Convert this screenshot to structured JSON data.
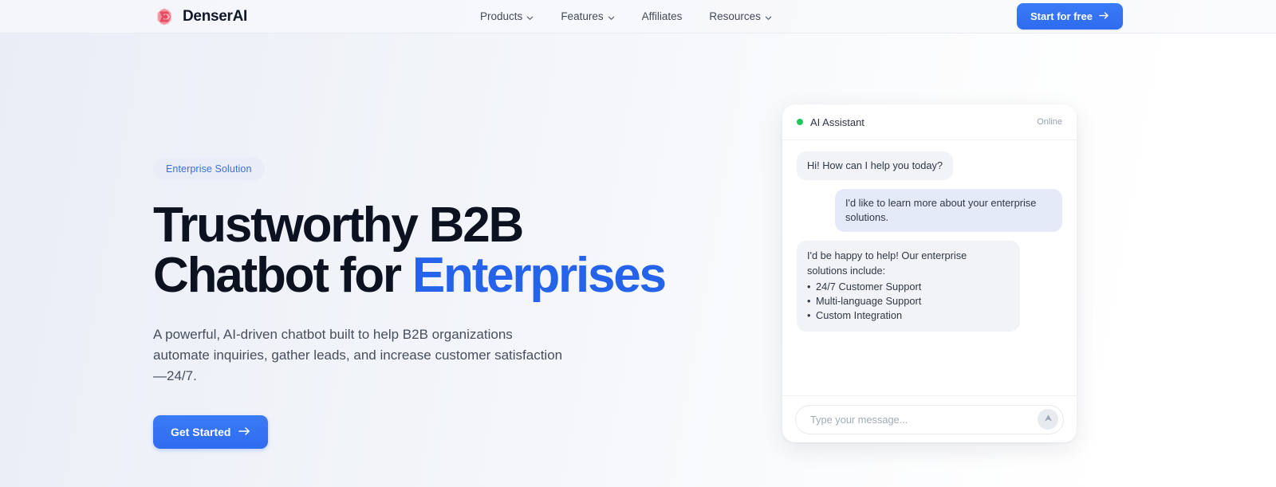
{
  "brand": {
    "name": "DenserAI",
    "logo_icon": "denser-diamond-logo",
    "accent_color": "#ef4056"
  },
  "nav": {
    "links": [
      {
        "label": "Products",
        "has_chevron": true,
        "icon": "chevron-down-icon"
      },
      {
        "label": "Features",
        "has_chevron": true,
        "icon": "chevron-down-icon"
      },
      {
        "label": "Affiliates",
        "has_chevron": false,
        "icon": ""
      },
      {
        "label": "Resources",
        "has_chevron": true,
        "icon": "chevron-down-icon"
      }
    ],
    "cta": {
      "label": "Start for free",
      "icon": "arrow-right-icon",
      "color": "#2e6bf0"
    }
  },
  "hero": {
    "badge": "Enterprise Solution",
    "headline_line1": "Trustworthy B2B",
    "headline_line2_plain": "Chatbot for ",
    "headline_line2_accent": "Enterprises",
    "accent_color": "#2563eb",
    "subhead": "A powerful, AI-driven chatbot built to help B2B organizations automate inquiries, gather leads, and increase customer satisfaction—24/7.",
    "cta": {
      "label": "Get Started",
      "icon": "arrow-right-icon"
    }
  },
  "chat": {
    "title": "AI Assistant",
    "status": "Online",
    "status_color": "#22c55e",
    "messages": [
      {
        "from": "bot",
        "text": "Hi! How can I help you today?"
      },
      {
        "from": "user",
        "text": "I'd like to learn more about your enterprise solutions."
      }
    ],
    "list_message": {
      "from": "bot",
      "text": "I'd be happy to help! Our enterprise solutions include:",
      "items": [
        "24/7 Customer Support",
        "Multi-language Support",
        "Custom Integration"
      ]
    },
    "input": {
      "placeholder": "Type your message...",
      "value": ""
    },
    "send_icon": "send-arrow-up-icon"
  }
}
